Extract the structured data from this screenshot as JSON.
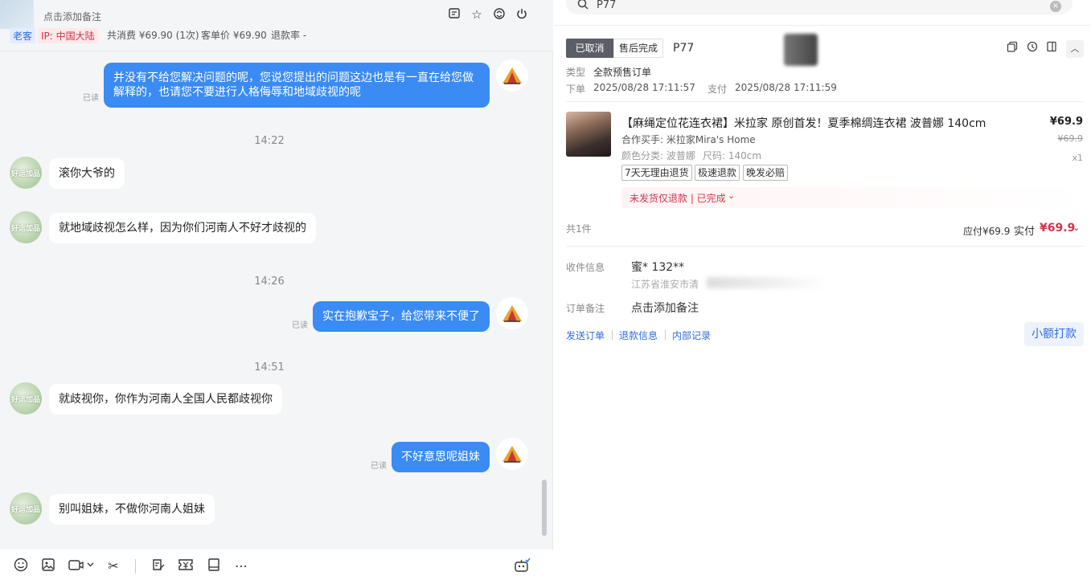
{
  "chat": {
    "header": {
      "note_link": "点击添加备注",
      "tag_customer": "老客",
      "tag_ip": "IP: 中国大陆",
      "total_spent": "共消费 ¥69.90 (1次)",
      "unit_price": "客单价 ¥69.90",
      "refund_rate": "退款率 -"
    },
    "messages": [
      {
        "dir": "out",
        "text_l1": "并没有不给您解决问题的呢，您说您提出的问题这边也是有一直在给您做",
        "text_l2": "解释的，也请您不要进行人格侮辱和地域歧视的呢",
        "read": "已读"
      },
      {
        "dir": "time",
        "text": "14:22"
      },
      {
        "dir": "in",
        "text": "滚你大爷的"
      },
      {
        "dir": "in",
        "text": "就地域歧视怎么样，因为你们河南人不好才歧视的"
      },
      {
        "dir": "time",
        "text": "14:26"
      },
      {
        "dir": "out",
        "text": "实在抱歉宝子，给您带来不便了",
        "read": "已读"
      },
      {
        "dir": "time",
        "text": "14:51"
      },
      {
        "dir": "in",
        "text": "就歧视你，你作为河南人全国人民都歧视你"
      },
      {
        "dir": "out",
        "text": "不好意思呢姐妹",
        "read": "已读"
      },
      {
        "dir": "in",
        "text": "别叫姐妹，不做你河南人姐妹"
      }
    ],
    "customer_avatar_text": "好运加品"
  },
  "order": {
    "search_value": "P77",
    "status_cancel": "已取消",
    "status_after": "售后完成",
    "order_no": "P77",
    "type_label": "类型",
    "type_value": "全款预售订单",
    "placed_label": "下单",
    "placed_value": "2025/08/28 17:11:57",
    "paid_label": "支付",
    "paid_value": "2025/08/28 17:11:59",
    "product": {
      "title": "【麻绳定位花连衣裙】米拉家 原创首发！夏季棉绸连衣裙 波普娜 140cm",
      "partner": "合作买手: 米拉家Mira's Home",
      "color": "颜色分类: 波普娜",
      "size": "尺码: 140cm",
      "tags": [
        "7天无理由退货",
        "极速退款",
        "晚发必赔"
      ],
      "price": "¥69.9",
      "orig_price": "¥69.9",
      "qty": "x1",
      "refund_status": "未发货仅退款 | 已完成"
    },
    "count": "共1件",
    "payable": "应付¥69.9",
    "actual_label": "实付",
    "actual": "¥69.9",
    "receiver_label": "收件信息",
    "receiver_name": "蜜* 132**",
    "receiver_addr": "江苏省淮安市清",
    "note_label": "订单备注",
    "note_value": "点击添加备注",
    "links": [
      "发送订单",
      "退款信息",
      "内部记录"
    ],
    "small_pay": "小额打款"
  }
}
